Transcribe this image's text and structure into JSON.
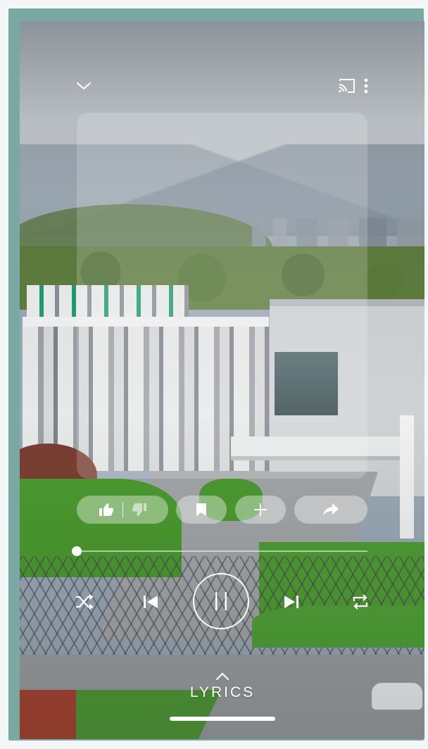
{
  "player": {
    "progress_fraction": 0.0,
    "state": "playing"
  },
  "top_bar": {
    "collapse_icon": "chevron-down-icon",
    "cast_icon": "cast-icon",
    "menu_icon": "more-vert-icon"
  },
  "actions": {
    "like_icon": "thumb-up-icon",
    "dislike_icon": "thumb-down-icon",
    "save_icon": "bookmark-icon",
    "add_icon": "plus-icon",
    "share_icon": "share-icon"
  },
  "controls": {
    "shuffle_icon": "shuffle-icon",
    "previous_icon": "skip-previous-icon",
    "play_pause_icon": "pause-icon",
    "next_icon": "skip-next-icon",
    "repeat_icon": "repeat-icon"
  },
  "lyrics": {
    "label": "LYRICS",
    "icon": "chevron-up-icon"
  },
  "colors": {
    "frame": "#7aa9a4",
    "foreground": "#ffffff"
  }
}
